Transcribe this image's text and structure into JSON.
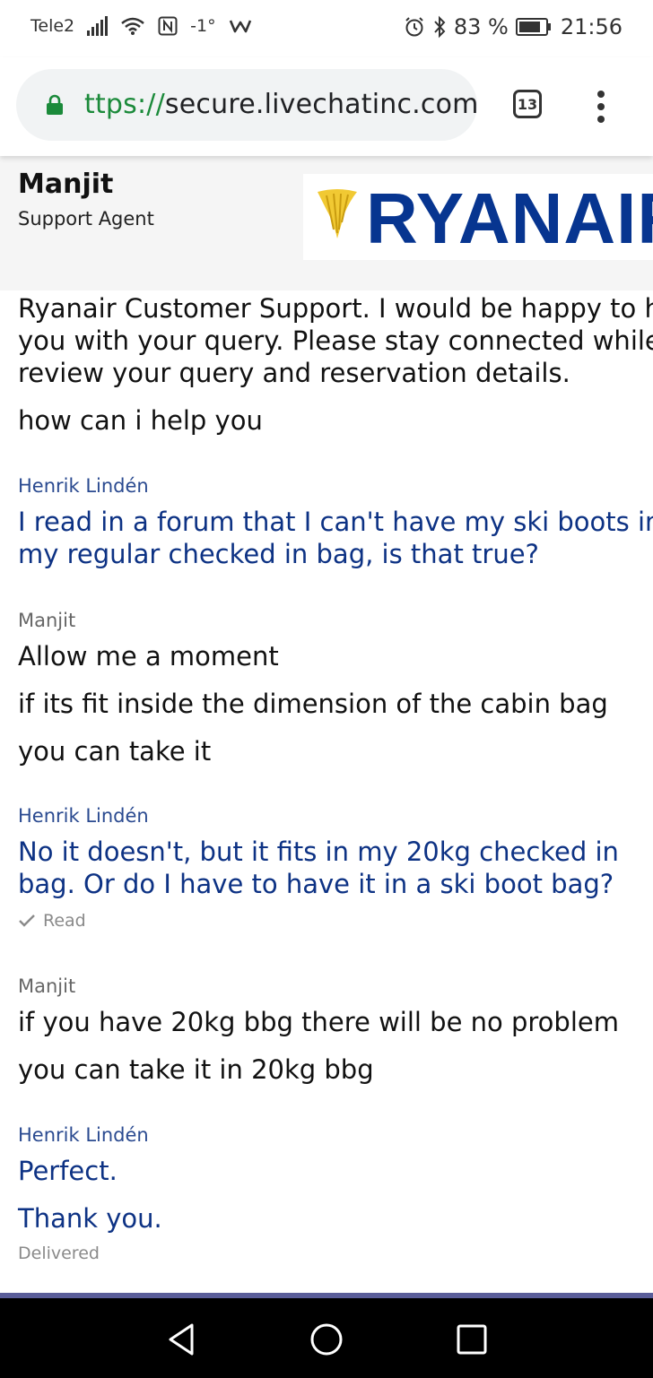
{
  "status_bar": {
    "carrier": "Tele2",
    "temperature": "-1°",
    "battery_percent": "83 %",
    "battery_level": 0.83,
    "time": "21:56"
  },
  "browser": {
    "url_scheme": "ttps://",
    "url_host": "secure.livechatinc.com",
    "tab_count": "13",
    "accent_color": "#1b8a3a"
  },
  "agent": {
    "name": "Manjit",
    "role": "Support Agent",
    "logo_text": "RYANAIR"
  },
  "chat": {
    "intro_lines": [
      "Ryanair Customer Support. I would be happy to help",
      "you with your query. Please stay connected while I",
      "review your query and reservation details."
    ],
    "intro_followup": "how can i help you",
    "visitor_name": "Henrik Lindén",
    "agent_name": "Manjit",
    "visitor_msg_1": [
      "I read in a forum that I can't have my ski boots in",
      "my regular checked in bag, is that true?"
    ],
    "agent_msgs_1": [
      "Allow me a moment",
      "if its fit inside the dimension of the cabin bag",
      "you can take it"
    ],
    "visitor_msg_2": [
      "No it doesn't, but it fits in my 20kg checked in",
      "bag. Or do I have to have it in a ski boot bag?"
    ],
    "read_status": "Read",
    "agent_msgs_2": [
      "if you have 20kg bbg there will be no problem",
      "you can take it in 20kg bbg"
    ],
    "visitor_msgs_3": [
      "Perfect.",
      "Thank you."
    ],
    "delivered_status": "Delivered"
  },
  "icons": [
    "signal-icon",
    "wifi-icon",
    "nfc-icon",
    "weather-icon",
    "alarm-icon",
    "bluetooth-icon",
    "battery-icon",
    "lock-icon",
    "tab-switcher-icon",
    "overflow-menu-icon",
    "back-nav-icon",
    "home-nav-icon",
    "recents-nav-icon",
    "check-icon"
  ]
}
